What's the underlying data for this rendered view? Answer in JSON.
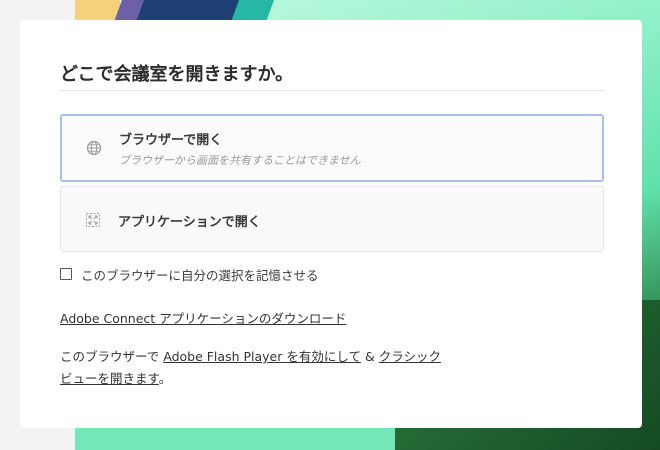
{
  "dialog": {
    "title": "どこで会議室を開きますか。",
    "options": [
      {
        "icon": "globe-icon",
        "label": "ブラウザーで開く",
        "sublabel": "ブラウザーから画面を共有することはできません",
        "selected": true
      },
      {
        "icon": "application-icon",
        "label": "アプリケーションで開く",
        "selected": false
      }
    ],
    "remember": {
      "label": "このブラウザーに自分の選択を記憶させる",
      "checked": false
    },
    "download_link": "Adobe Connect アプリケーションのダウンロード",
    "flash": {
      "prefix": "このブラウザーで ",
      "flash_link": "Adobe Flash Player を有効にして",
      "amp": " & ",
      "classic_link_line1": "クラシック",
      "classic_link_line2": "ビューを開きます",
      "suffix": "。"
    }
  },
  "colors": {
    "selected_border": "#a9c0ee",
    "card_background": "#ffffff",
    "text": "#3a3a3a"
  }
}
